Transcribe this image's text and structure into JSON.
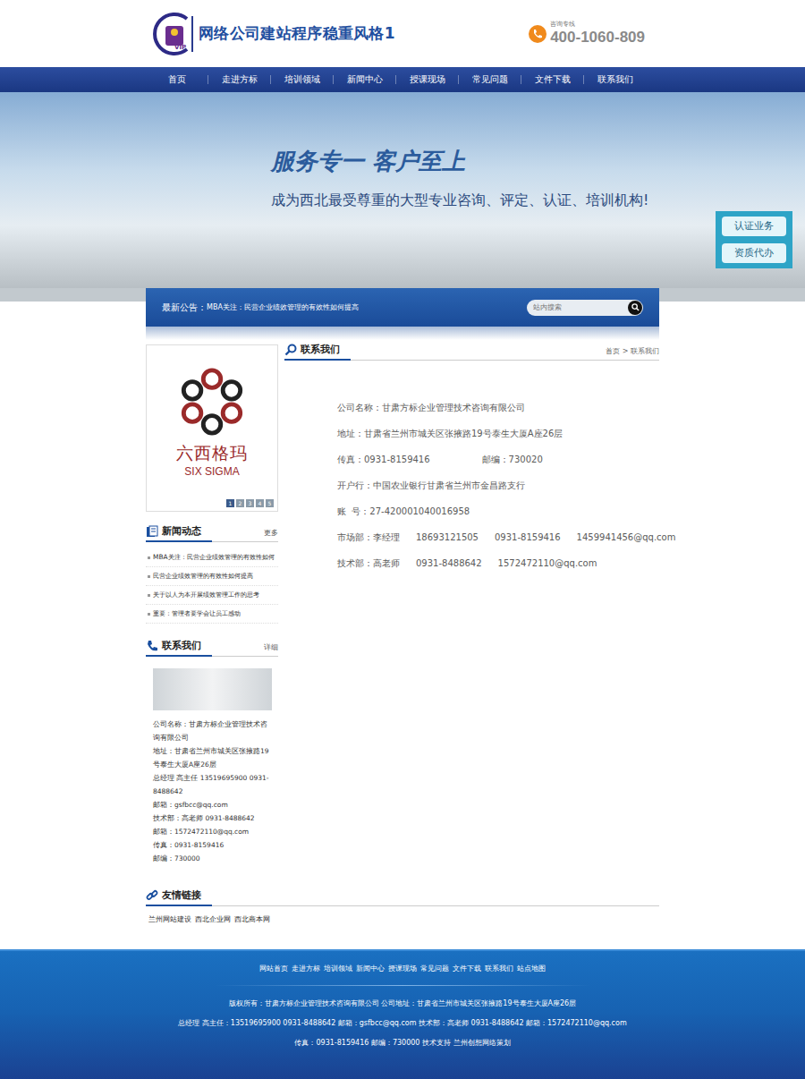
{
  "header": {
    "logo_badge": "VIP",
    "title": "网络公司建站程序稳重风格1",
    "hotline_label": "咨询专线",
    "hotline": "400-1060-809"
  },
  "nav": [
    {
      "label": "首页",
      "selected": false
    },
    {
      "label": "走进方标",
      "selected": false
    },
    {
      "label": "培训领域",
      "selected": false
    },
    {
      "label": "新闻中心",
      "selected": false
    },
    {
      "label": "授课现场",
      "selected": false
    },
    {
      "label": "常见问题",
      "selected": false
    },
    {
      "label": "文件下载",
      "selected": false
    },
    {
      "label": "联系我们",
      "selected": false
    }
  ],
  "banner": {
    "slogan": "服务专一  客户至上",
    "tagline": "成为西北最受尊重的大型专业咨询、评定、认证、培训机构!",
    "side_buttons": [
      "认证业务",
      "资质代办"
    ]
  },
  "notice": {
    "label": "最新公告：",
    "text": "MBA关注：民营企业绩效管理的有效性如何提高"
  },
  "search": {
    "placeholder": "站内搜索"
  },
  "slide": {
    "logo_cn": "六西格玛",
    "logo_en": "SIX SIGMA",
    "pages": [
      {
        "label": "1",
        "selected": true
      },
      {
        "label": "2",
        "selected": false
      },
      {
        "label": "3",
        "selected": false
      },
      {
        "label": "4",
        "selected": false
      },
      {
        "label": "5",
        "selected": false
      }
    ]
  },
  "news": {
    "title": "新闻动态",
    "more": "更多",
    "items": [
      "MBA关注：民营企业绩效管理的有效性如何",
      "民营企业绩效管理的有效性如何提高",
      "关于以人为本开展绩效管理工作的思考",
      "重要：管理者要学会让员工感动"
    ]
  },
  "contact_box": {
    "title": "联系我们",
    "more": "详细",
    "lines": [
      "公司名称：甘肃方标企业管理技术咨询有限公司",
      "地址：甘肃省兰州市城关区张掖路19号泰生大厦A座26层",
      "总经理 高主任 13519695900 0931-8488642",
      "邮箱：gsfbcc@qq.com",
      "技术部：高老师 0931-8488642",
      "邮箱：1572472110@qq.com",
      "传真：0931-8159416",
      "邮编：730000"
    ]
  },
  "page": {
    "title": "联系我们",
    "breadcrumb": "首页 > 联系我们"
  },
  "contact_info": [
    [
      "公司名称：甘肃方标企业管理技术咨询有限公司"
    ],
    [
      "地址：甘肃省兰州市城关区张掖路19号泰生大厦A座26层"
    ],
    [
      "传真：0931-8159416",
      "邮编：730020"
    ],
    [
      "开户行：中国农业银行甘肃省兰州市金昌路支行"
    ],
    [
      "账  号：27-420001040016958"
    ],
    [
      "市场部：李经理",
      "18693121505",
      "0931-8159416",
      "1459941456@qq.com"
    ],
    [
      "技术部：高老师",
      "0931-8488642",
      "1572472110@qq.com"
    ]
  ],
  "links": {
    "title": "友情链接",
    "items": [
      "兰州网站建设",
      "西北企业网",
      "西北商本网"
    ]
  },
  "footer": {
    "links": [
      "网站首页",
      "走进方标",
      "培训领域",
      "新闻中心",
      "授课现场",
      "常见问题",
      "文件下载",
      "联系我们",
      "站点地图"
    ],
    "lines": [
      "版权所有：甘肃方标企业管理技术咨询有限公司  公司地址：甘肃省兰州市城关区张掖路19号泰生大厦A座26层",
      "总经理 高主任：13519695900 0931-8488642 邮箱：gsfbcc@qq.com 技术部：高老师 0931-8488642 邮箱：1572472110@qq.com",
      "传真：0931-8159416 邮编：730000 技术支持 兰州创想网络策划"
    ]
  }
}
